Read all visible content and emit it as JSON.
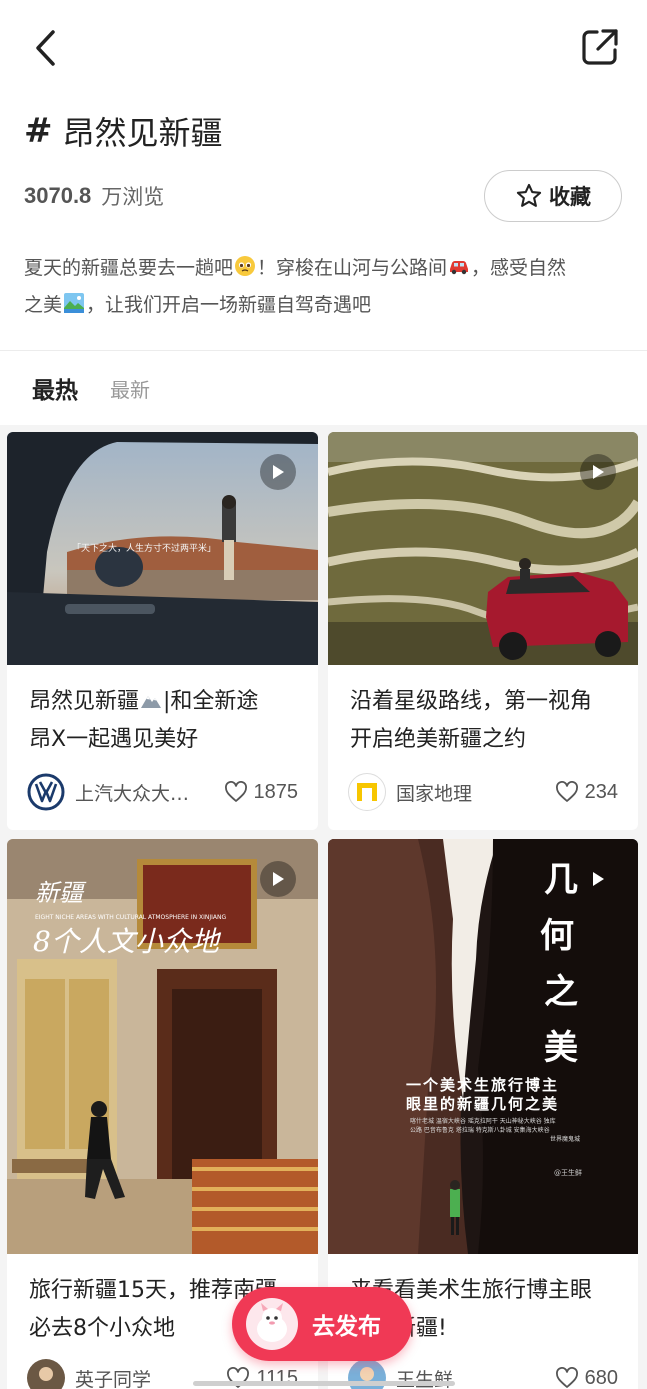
{
  "header": {
    "back_icon": "chevron-left-icon",
    "share_icon": "share-external-icon",
    "hash": "#",
    "title": "昂然见新疆",
    "views_count": "3070.8",
    "views_unit": "万浏览",
    "favorite_label": "收藏",
    "favorite_icon": "star-icon",
    "description_line1_a": "夏天的新疆总要去一趟吧",
    "description_line1_b": "！穿梭在山河与公路间",
    "description_line1_c": "，感受自然",
    "description_line2_a": "之美",
    "description_line2_b": "，让我们开启一场新疆自驾奇遇吧"
  },
  "tabs": [
    {
      "label": "最热",
      "active": true
    },
    {
      "label": "最新",
      "active": false
    }
  ],
  "cards": [
    {
      "title_a": "昂然见新疆",
      "title_b": "|和全新途",
      "title_line2": "昂X一起遇见美好",
      "author": "上汽大众大…",
      "likes": "1875",
      "overlay_text": "「天下之大，人生方寸不过两平米」"
    },
    {
      "title_line1": "沿着星级路线，第一视角",
      "title_line2": "开启绝美新疆之约",
      "author": "国家地理",
      "likes": "234"
    },
    {
      "title_line1": "旅行新疆15天，推荐南疆",
      "title_line2": "必去8个小众地",
      "author": "英子同学",
      "likes": "1115",
      "overlay_title": "新疆",
      "overlay_en": "EIGHT NICHE AREAS WITH CULTURAL ATMOSPHERE IN XINJIANG",
      "overlay_sub": "8个人文小众地"
    },
    {
      "title_line1": "来看看美术生旅行博主眼",
      "title_line2": "里的新疆!",
      "author": "王生鲜",
      "likes": "680",
      "overlay_title": [
        "几",
        "何",
        "之",
        "美"
      ],
      "overlay_line1": "一个美术生旅行博主",
      "overlay_line2": "眼里的新疆几何之美",
      "overlay_small1": "喀什老城 温宿大峡谷 瑶克拉阿干 天山神秘大峡谷 独库",
      "overlay_small2": "公路 巴音布鲁克 塔拉瑞 特克斯八卦城 安集海大峡谷",
      "overlay_small3": "世界魔鬼城",
      "overlay_handle": "@王生鲜"
    }
  ],
  "publish": {
    "label": "去发布"
  },
  "colors": {
    "accent": "#f03955",
    "feed_bg": "#f4f4f4"
  }
}
